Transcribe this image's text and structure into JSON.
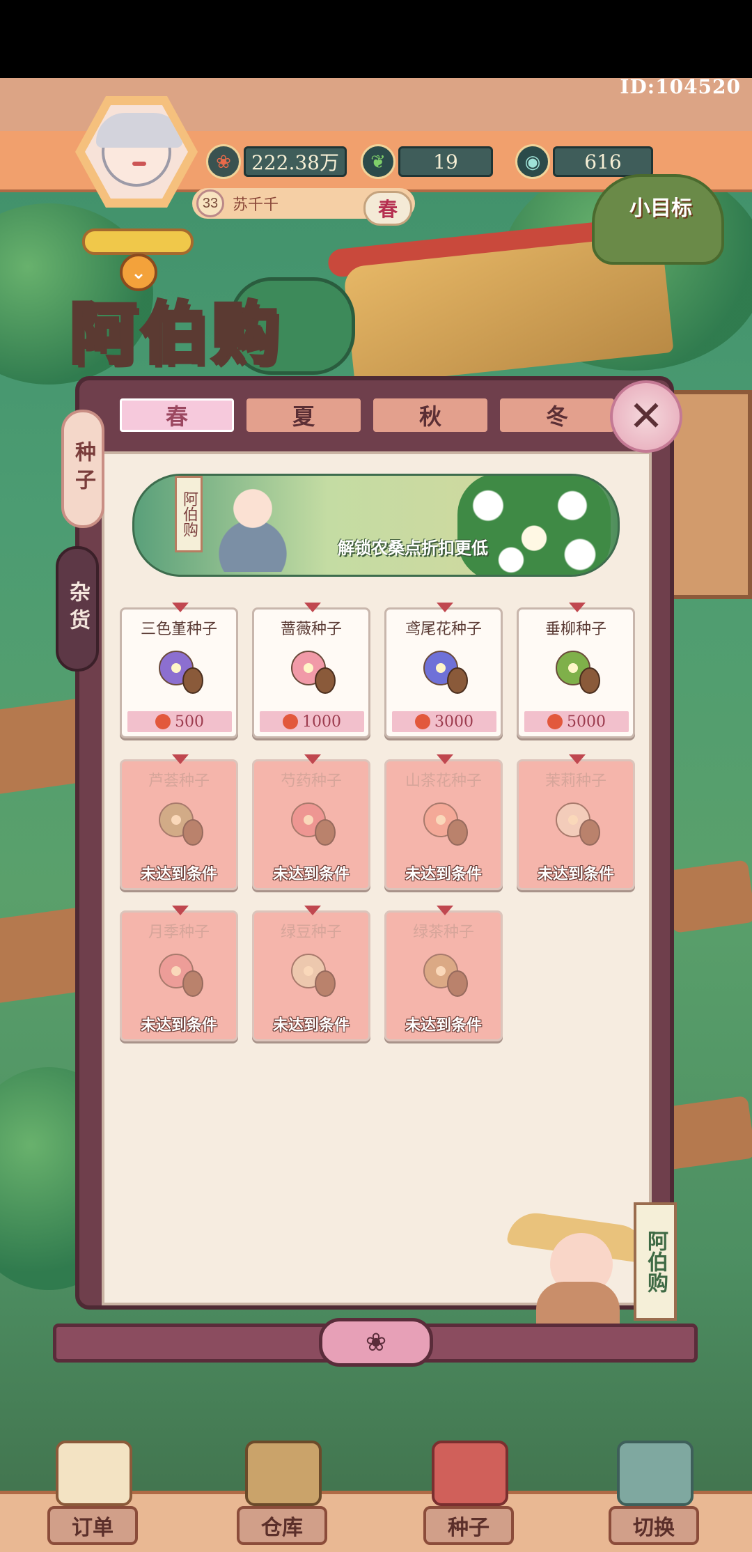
{
  "header": {
    "id_label": "ID:104520",
    "username": "苏千千",
    "level": "33",
    "season_badge": "春",
    "goal_label": "小目标"
  },
  "resources": [
    {
      "icon": "flower-coin-icon",
      "value": "222.38万"
    },
    {
      "icon": "leaf-icon",
      "value": "19"
    },
    {
      "icon": "gem-icon",
      "value": "616"
    }
  ],
  "shop": {
    "title": "阿伯购",
    "tag": "阿伯购"
  },
  "season_tabs": [
    {
      "label": "春",
      "active": true
    },
    {
      "label": "夏",
      "active": false
    },
    {
      "label": "秋",
      "active": false
    },
    {
      "label": "冬",
      "active": false
    }
  ],
  "side_tabs": [
    {
      "label": "种子",
      "active": true
    },
    {
      "label": "杂货",
      "active": false
    }
  ],
  "banner": {
    "tag": "阿伯购",
    "text": "解锁农桑点折扣更低"
  },
  "items": [
    {
      "name": "三色堇种子",
      "price": "500",
      "locked": false,
      "icon": "pansy-seed-icon",
      "color": "#8c6fd0"
    },
    {
      "name": "蔷薇种子",
      "price": "1000",
      "locked": false,
      "icon": "rose-seed-icon",
      "color": "#f19aa8"
    },
    {
      "name": "鸢尾花种子",
      "price": "3000",
      "locked": false,
      "icon": "iris-seed-icon",
      "color": "#6f71d8"
    },
    {
      "name": "垂柳种子",
      "price": "5000",
      "locked": false,
      "icon": "willow-seed-icon",
      "color": "#7fb04a"
    },
    {
      "name": "芦荟种子",
      "lock_text": "未达到条件",
      "locked": true,
      "icon": "aloe-seed-icon",
      "color": "#b7a46a"
    },
    {
      "name": "芍药种子",
      "lock_text": "未达到条件",
      "locked": true,
      "icon": "peony-seed-icon",
      "color": "#e97e7e"
    },
    {
      "name": "山茶花种子",
      "lock_text": "未达到条件",
      "locked": true,
      "icon": "camellia-seed-icon",
      "color": "#f4a08a"
    },
    {
      "name": "茉莉种子",
      "lock_text": "未达到条件",
      "locked": true,
      "icon": "jasmine-seed-icon",
      "color": "#f3e0c8"
    },
    {
      "name": "月季种子",
      "lock_text": "未达到条件",
      "locked": true,
      "icon": "china-rose-seed-icon",
      "color": "#e88a8a"
    },
    {
      "name": "绿豆种子",
      "lock_text": "未达到条件",
      "locked": true,
      "icon": "mung-bean-seed-icon",
      "color": "#e8d8b2"
    },
    {
      "name": "绿茶种子",
      "lock_text": "未达到条件",
      "locked": true,
      "icon": "green-tea-seed-icon",
      "color": "#c7a167"
    }
  ],
  "bottom_nav": [
    {
      "label": "订单",
      "icon": "clipboard-icon"
    },
    {
      "label": "仓库",
      "icon": "warehouse-icon"
    },
    {
      "label": "种子",
      "icon": "seed-book-icon"
    },
    {
      "label": "切换",
      "icon": "map-icon"
    }
  ]
}
